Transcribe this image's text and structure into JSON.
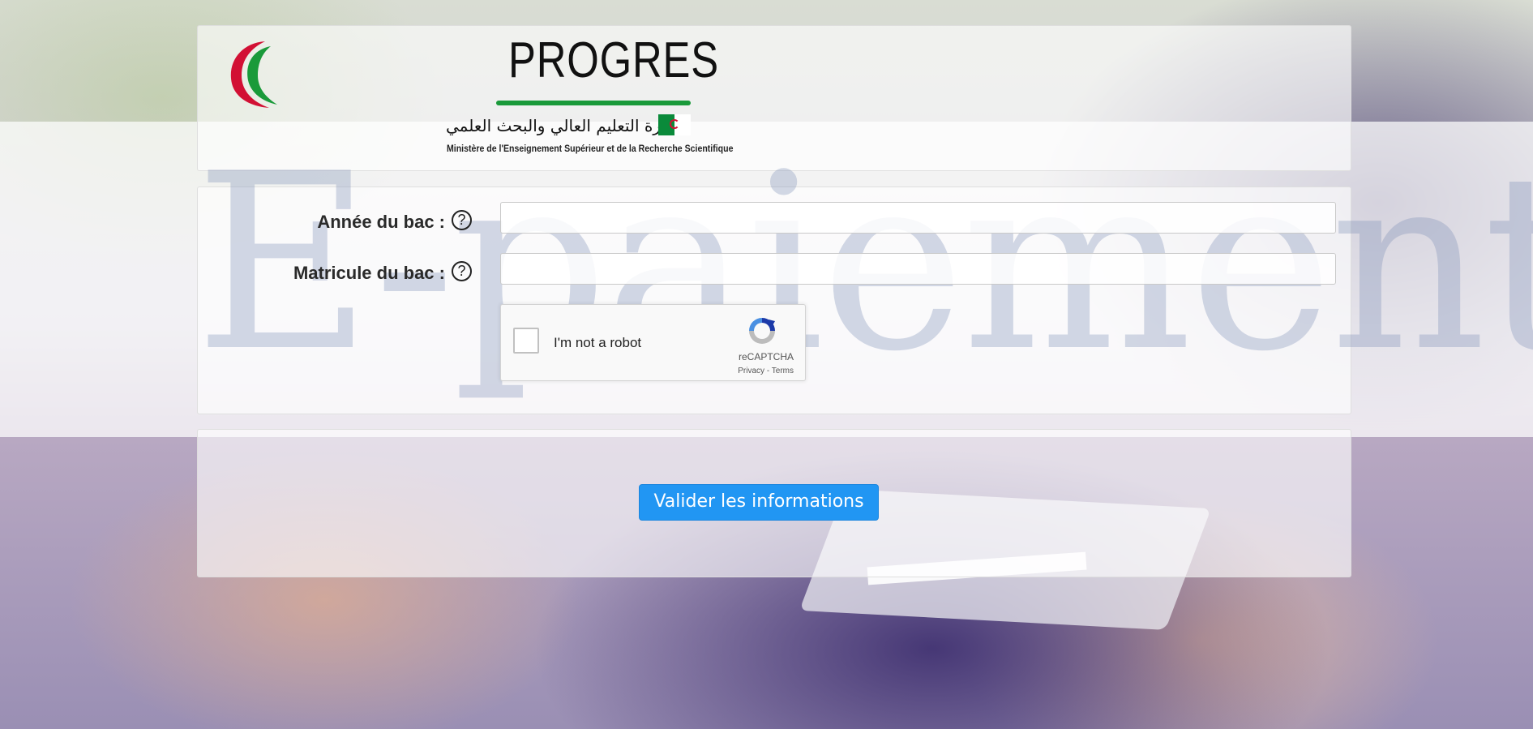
{
  "logo": {
    "brand": "PROGRES",
    "ministry_ar": "وزارة التعليم العالي والبحث العلمي",
    "ministry_fr": "Ministère de l'Enseignement Supérieur et de la Recherche Scientifique"
  },
  "background": {
    "watermark": "E-paiement"
  },
  "form": {
    "annee_label": "Année du bac :",
    "annee_value": "",
    "matricule_label": "Matricule du bac :",
    "matricule_value": "",
    "help_glyph": "?"
  },
  "recaptcha": {
    "label": "I'm not a robot",
    "brand": "reCAPTCHA",
    "privacy": "Privacy",
    "separator": " - ",
    "terms": "Terms",
    "checked": false
  },
  "submit": {
    "label": "Valider les informations",
    "color": "#2196f3"
  },
  "colors": {
    "logo_green": "#1a9a3a",
    "logo_red": "#d21034"
  }
}
